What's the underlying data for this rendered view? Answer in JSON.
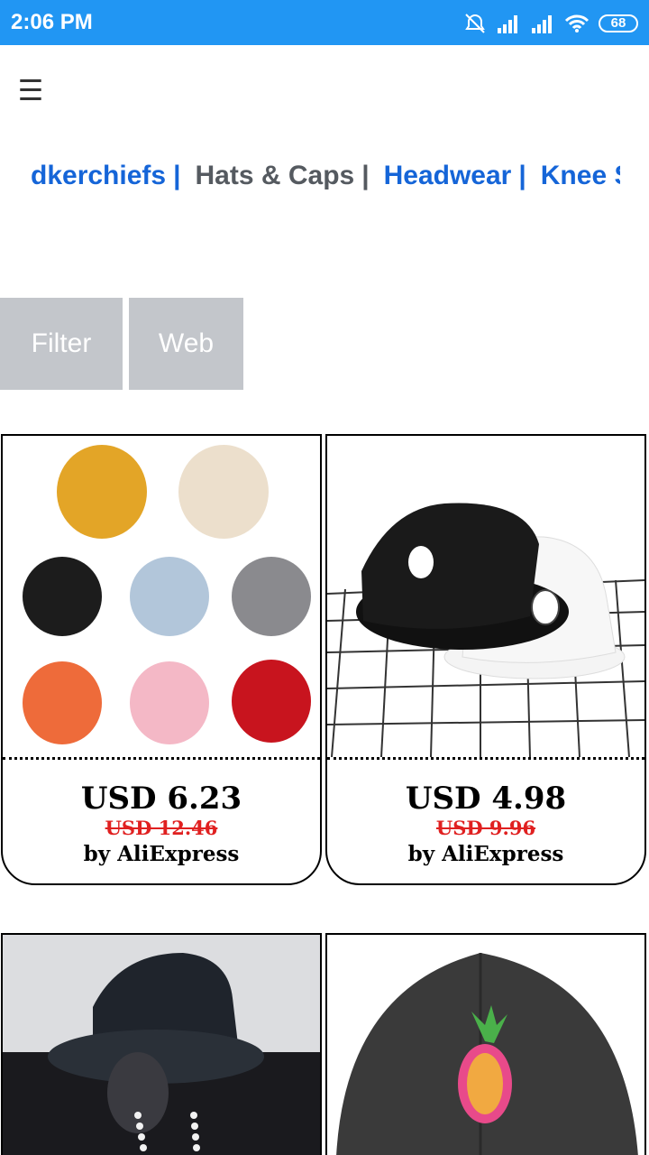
{
  "status_bar": {
    "time": "2:06 PM",
    "battery": "68",
    "icons": [
      "alarm-off-icon",
      "signal-icon",
      "signal-icon",
      "wifi-icon",
      "battery-icon"
    ]
  },
  "menu_icon": "hamburger-menu-icon",
  "categories": [
    {
      "label": "dkerchiefs",
      "active": false
    },
    {
      "label": "Hats & Caps",
      "active": true
    },
    {
      "label": "Headwear",
      "active": false
    },
    {
      "label": "Knee S",
      "active": false
    }
  ],
  "separator": "|",
  "buttons": {
    "filter": "Filter",
    "web": "Web"
  },
  "products": [
    {
      "image": "knit-beanies-image",
      "price": "USD 6.23",
      "old_price": "USD 12.46",
      "seller": "by AliExpress"
    },
    {
      "image": "bucket-hats-image",
      "price": "USD 4.98",
      "old_price": "USD 9.96",
      "seller": "by AliExpress"
    },
    {
      "image": "black-bucket-hat-image"
    },
    {
      "image": "pineapple-cap-image"
    }
  ],
  "colors": {
    "status_bar": "#2196f3",
    "category_link": "#1565d8",
    "category_active": "#555a60",
    "button_bg": "#c3c6cb",
    "old_price": "#e02020"
  }
}
